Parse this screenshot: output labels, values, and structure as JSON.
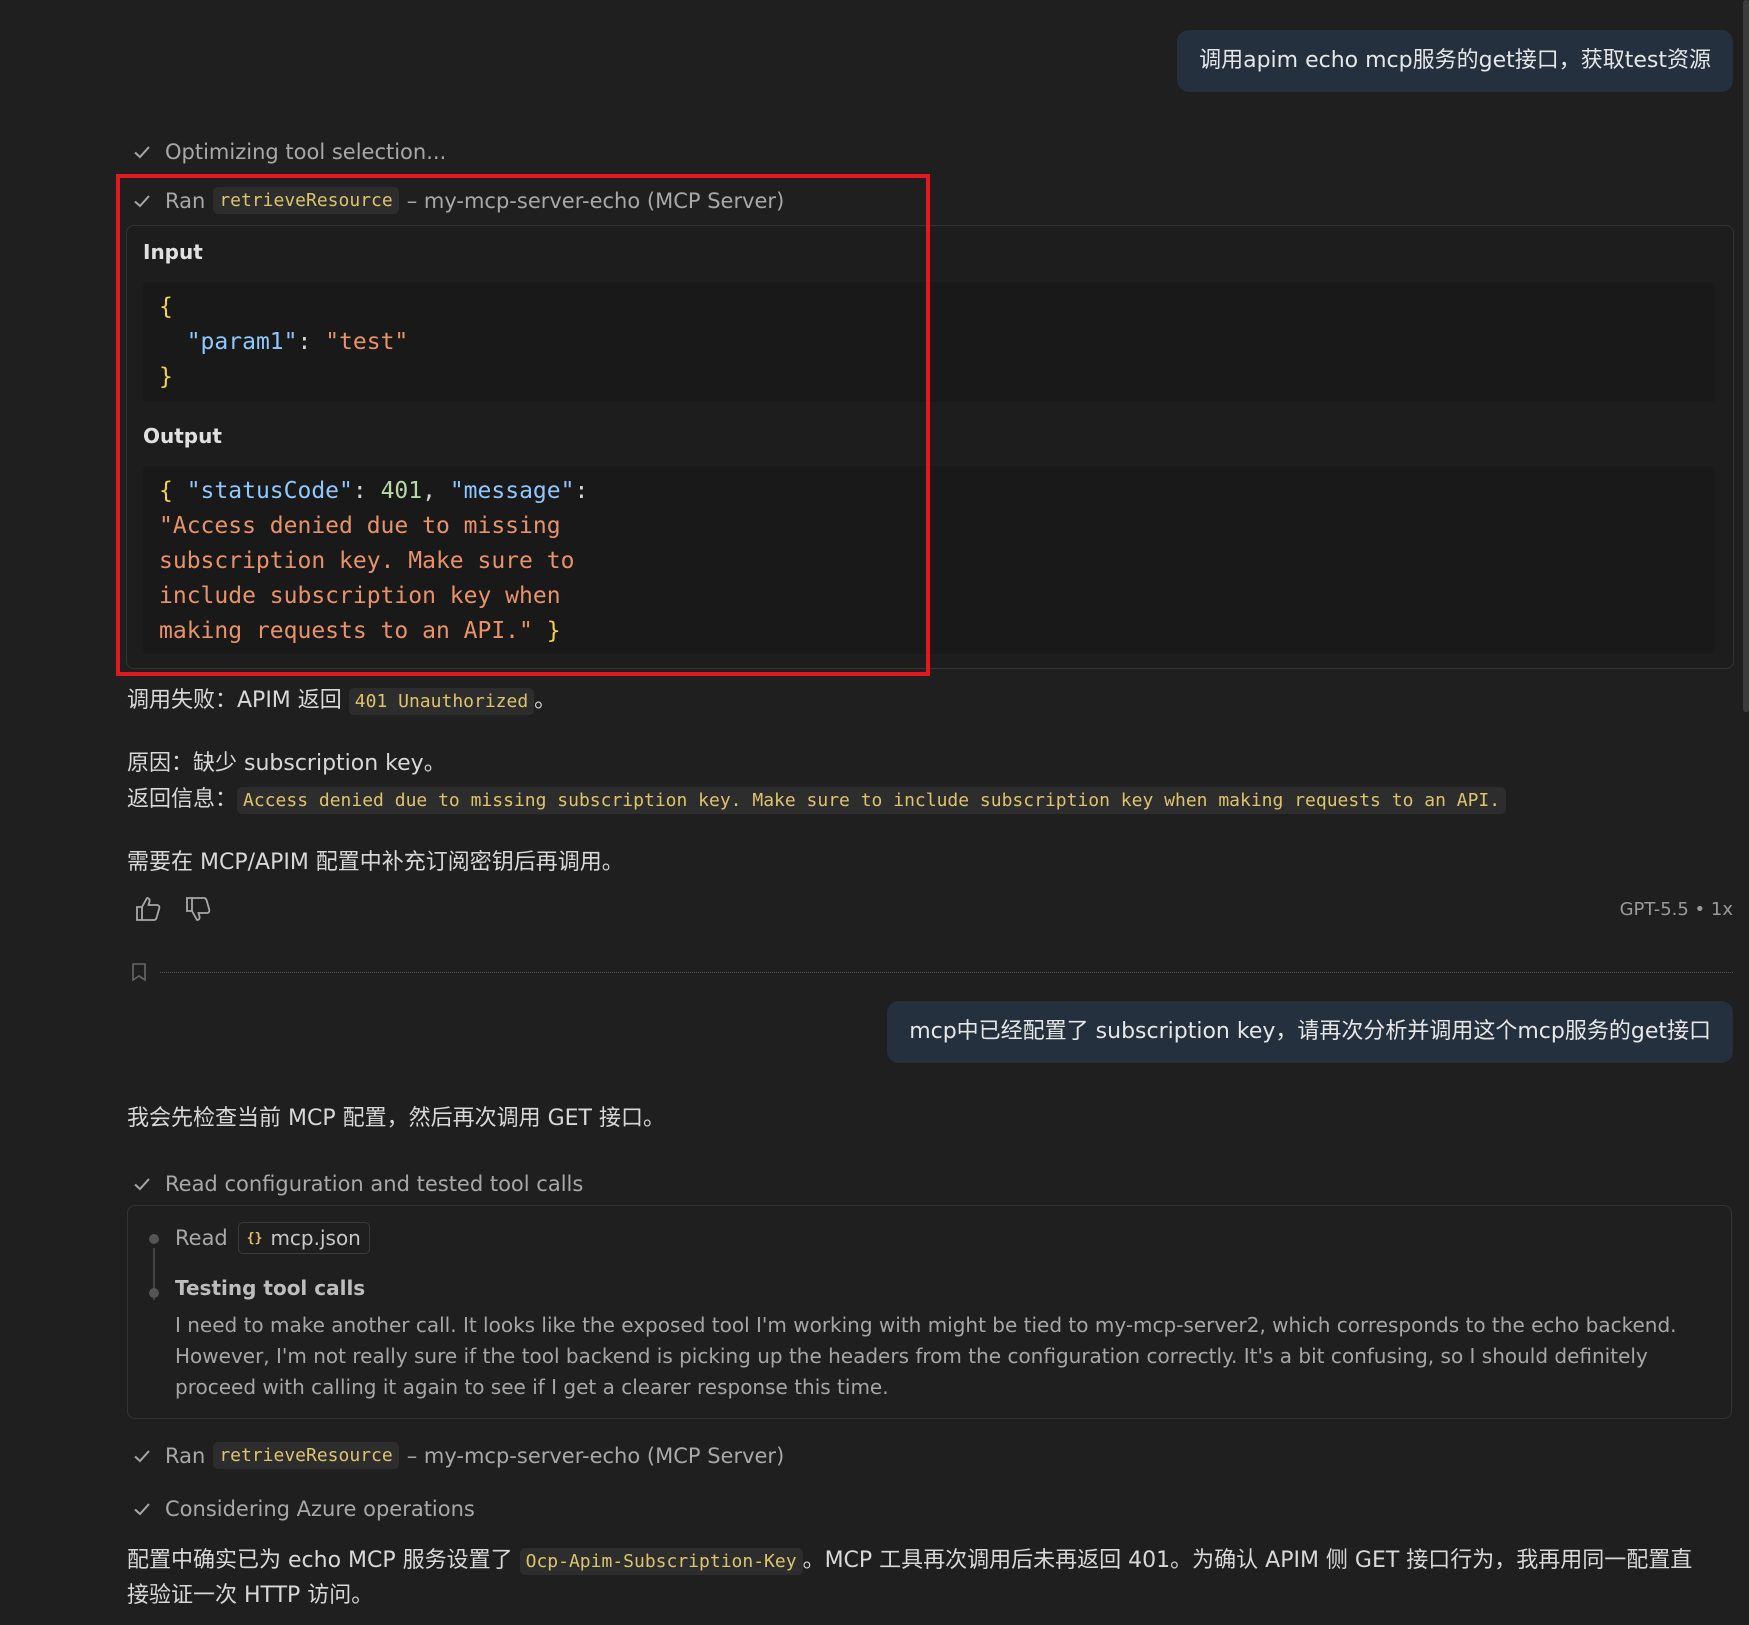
{
  "messages": {
    "user1": "调用apim echo mcp服务的get接口，获取test资源",
    "user2": "mcp中已经配置了 subscription key，请再次分析并调用这个mcp服务的get接口"
  },
  "steps": {
    "optimizing": "Optimizing tool selection...",
    "ran1": {
      "prefix": "Ran",
      "tool": "retrieveResource",
      "suffix": "– my-mcp-server-echo (MCP Server)"
    },
    "read_config": "Read configuration and tested tool calls",
    "ran2": {
      "prefix": "Ran",
      "tool": "retrieveResource",
      "suffix": "– my-mcp-server-echo (MCP Server)"
    },
    "considering": "Considering Azure operations"
  },
  "tool_panel": {
    "input_label": "Input",
    "input_key": "\"param1\"",
    "input_value": "\"test\"",
    "output_label": "Output",
    "output_key1": "\"statusCode\"",
    "output_num": "401",
    "output_key2": "\"message\"",
    "output_msg_lines": [
      "\"Access denied due to missing",
      "subscription key. Make sure to",
      "include subscription key when",
      "making requests to an API.\""
    ]
  },
  "response1": {
    "fail_prefix": "调用失败：APIM 返回",
    "fail_code": "401 Unauthorized",
    "fail_suffix": "。",
    "reason": "原因：缺少 subscription key。",
    "return_prefix": "返回信息：",
    "return_code": "Access denied due to missing subscription key. Make sure to include subscription key when making requests to an API.",
    "need": "需要在 MCP/APIM 配置中补充订阅密钥后再调用。"
  },
  "feedback": {
    "thumbs_up": "thumbs-up-icon",
    "thumbs_down": "thumbs-down-icon",
    "model": "GPT-5.5 • 1x"
  },
  "response2": {
    "intro": "我会先检查当前 MCP 配置，然后再次调用 GET 接口。",
    "reason_read_prefix": "Read",
    "reason_file": "mcp.json",
    "reason_title": "Testing tool calls",
    "reason_body": "I need to make another call. It looks like the exposed tool I'm working with might be tied to my-mcp-server2, which corresponds to the echo backend. However, I'm not really sure if the tool backend is picking up the headers from the configuration correctly. It's a bit confusing, so I should definitely proceed with calling it again to see if I get a clearer response this time.",
    "final_prefix": "配置中确实已为 echo MCP 服务设置了",
    "final_code": "Ocp-Apim-Subscription-Key",
    "final_suffix_line1": "。MCP 工具再次调用后未再返回 401。为确认 APIM 侧 GET 接口行为，我再用同一配置直",
    "final_line2": "接验证一次 HTTP 访问。"
  },
  "colors": {
    "background": "#1f1f1f",
    "user_bubble": "#24303d",
    "highlight": "#e3181f",
    "inline_code": "#dcc46d"
  }
}
